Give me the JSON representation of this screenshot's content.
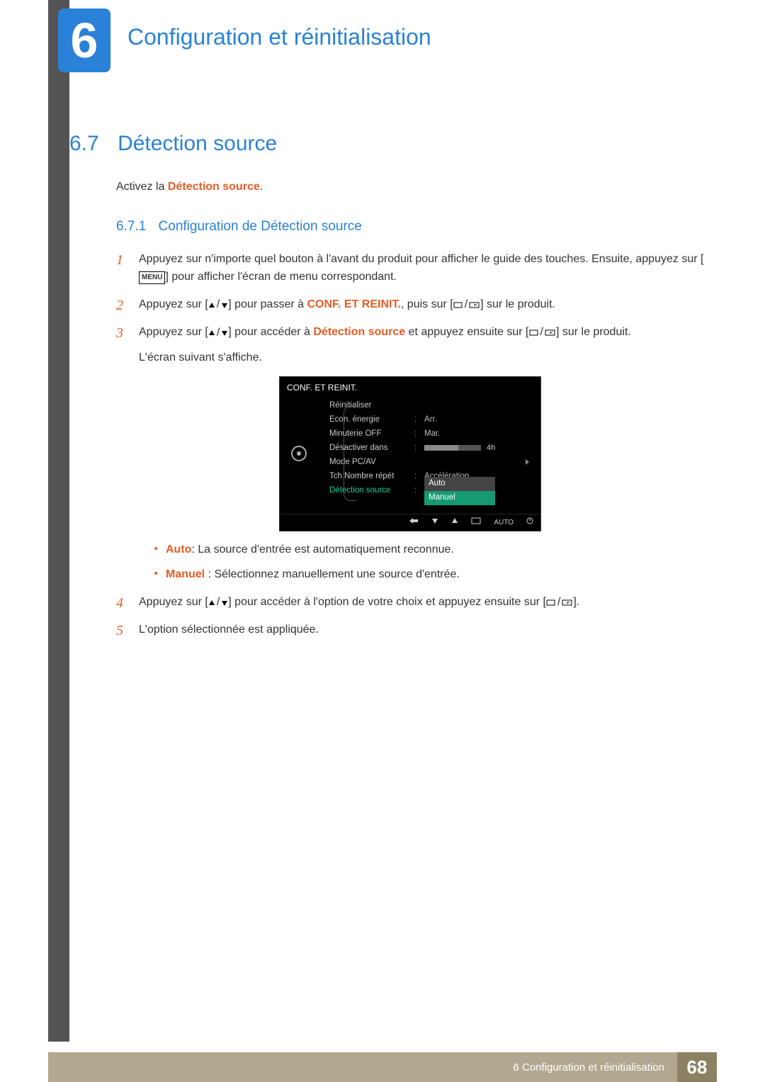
{
  "chapter": {
    "number": "6",
    "title": "Configuration et réinitialisation"
  },
  "section": {
    "number": "6.7",
    "title": "Détection source"
  },
  "intro": {
    "prefix": "Activez la ",
    "highlight": "Détection source",
    "suffix": "."
  },
  "sub": {
    "number": "6.7.1",
    "title": "Configuration de Détection source"
  },
  "steps": {
    "s1a": "Appuyez sur n'importe quel bouton à l'avant du produit pour afficher le guide des touches. Ensuite, appuyez sur [",
    "menu": "MENU",
    "s1b": "] pour afficher l'écran de menu correspondant.",
    "s2a": "Appuyez sur [",
    "s2b": "] pour passer à ",
    "conf": "CONF. ET REINIT.",
    "s2c": ", puis sur [",
    "s2d": "] sur le produit.",
    "s3a": "Appuyez sur [",
    "s3b": "] pour accéder à ",
    "det": "Détection source",
    "s3c": " et appuyez ensuite sur [",
    "s3d": "] sur le produit.",
    "s3e": "L'écran suivant s'affiche.",
    "s4a": "Appuyez sur [",
    "s4b": "] pour accéder à l'option de votre choix et appuyez ensuite sur [",
    "s4c": "].",
    "s5": "L'option sélectionnée est appliquée."
  },
  "osd": {
    "title": "CONF. ET REINIT.",
    "rows": {
      "r1": "Réinitialiser",
      "r2": "Econ. énergie",
      "v2": "Arr.",
      "r3": "Minuterie OFF",
      "v3": "Mar.",
      "r4": "Désactiver dans",
      "v4": "4h",
      "r5": "Mode PC/AV",
      "r6": "Tch Nombre répét",
      "v6": "Accélération",
      "r7": "Détection source",
      "opt1": "Auto",
      "opt2": "Manuel"
    },
    "nav": {
      "auto": "AUTO"
    }
  },
  "bullets": {
    "b1a": "Auto",
    "b1b": ": La source d'entrée est automatiquement reconnue.",
    "b2a": "Manuel",
    "b2b": " : Sélectionnez manuellement une source d'entrée."
  },
  "footer": {
    "text": "6 Configuration et réinitialisation",
    "page": "68"
  }
}
